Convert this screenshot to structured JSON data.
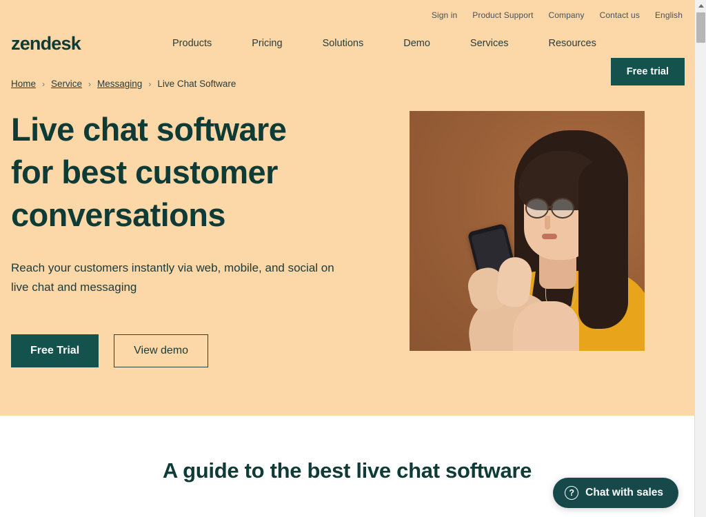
{
  "utility_bar": {
    "links": [
      {
        "label": "Sign in"
      },
      {
        "label": "Product Support"
      },
      {
        "label": "Company"
      },
      {
        "label": "Contact us"
      },
      {
        "label": "English"
      }
    ]
  },
  "header": {
    "logo": "zendesk",
    "nav_items": [
      {
        "label": "Products"
      },
      {
        "label": "Pricing"
      },
      {
        "label": "Solutions"
      },
      {
        "label": "Demo"
      },
      {
        "label": "Services"
      },
      {
        "label": "Resources"
      }
    ],
    "free_trial_label": "Free trial"
  },
  "breadcrumb": {
    "items": [
      {
        "label": "Home",
        "link": true
      },
      {
        "label": "Service",
        "link": true
      },
      {
        "label": "Messaging",
        "link": true
      },
      {
        "label": "Live Chat Software",
        "link": false
      }
    ],
    "separator": "›"
  },
  "hero": {
    "headline_line1": "Live chat software",
    "headline_line2": "for best customer",
    "headline_line3": "conversations",
    "subhead_line1": "Reach your customers instantly via web, mobile, and",
    "subhead_line2": "social on live chat and messaging",
    "primary_cta": "Free Trial",
    "secondary_cta": "View demo",
    "image_alt": "Woman with glasses in yellow blouse looking at a smartphone"
  },
  "guide_section": {
    "title": "A guide to the best live chat software"
  },
  "chat_widget": {
    "icon": "question-circle-icon",
    "icon_glyph": "?",
    "label": "Chat with sales"
  },
  "colors": {
    "hero_background": "#fcd7a8",
    "brand_dark": "#14534d",
    "heading": "#0f3b36",
    "chat_widget": "#17494a",
    "photo_backdrop": "#9a6038",
    "blouse": "#e8a41a"
  }
}
